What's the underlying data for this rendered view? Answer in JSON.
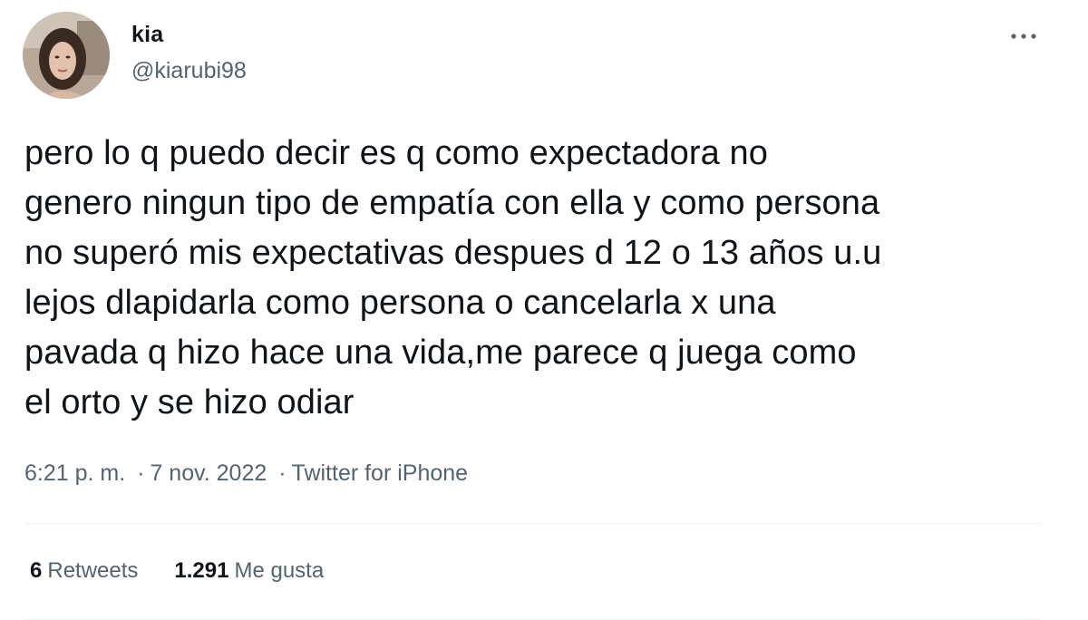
{
  "author": {
    "display_name": "kia",
    "handle": "@kiarubi98"
  },
  "tweet": {
    "text": "pero lo q puedo decir es q como expectadora no\ngenero ningun tipo de empatía con ella y como persona\nno superó mis expectativas despues d 12 o 13 años u.u\nlejos dlapidarla como persona o cancelarla x una\npavada q hizo hace una vida,me parece q juega como\nel orto y se hizo odiar"
  },
  "meta": {
    "time": "6:21 p. m.",
    "separator": "·",
    "date": "7 nov. 2022",
    "source": "Twitter for iPhone"
  },
  "stats": {
    "retweets_count": "6",
    "retweets_label": "Retweets",
    "likes_count": "1.291",
    "likes_label": "Me gusta"
  },
  "icons": {
    "more": "more-horizontal-icon"
  },
  "colors": {
    "text_primary": "#0f1419",
    "text_secondary": "#536471",
    "divider": "#eff3f4"
  }
}
